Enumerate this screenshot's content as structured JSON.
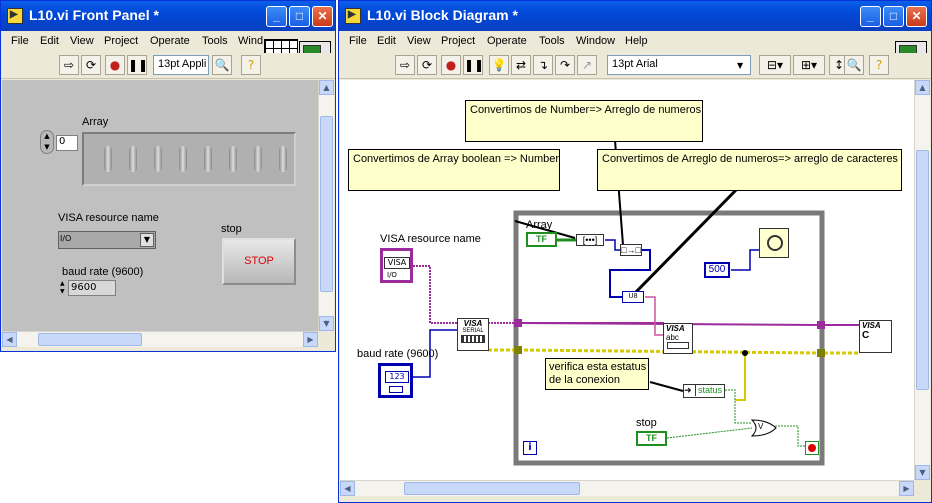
{
  "front_panel": {
    "title": "L10.vi Front Panel *",
    "menus": [
      "File",
      "Edit",
      "View",
      "Project",
      "Operate",
      "Tools",
      "Wind"
    ],
    "font_selector": "13pt Appli",
    "array_label": "Array",
    "array_index": "0",
    "visa_label": "VISA resource name",
    "visa_prefix": "I/O",
    "baud_label": "baud rate (9600)",
    "baud_value": "9600",
    "stop_label": "stop",
    "stop_button": "STOP"
  },
  "block_diagram": {
    "title": "L10.vi Block Diagram *",
    "menus": [
      "File",
      "Edit",
      "View",
      "Project",
      "Operate",
      "Tools",
      "Window",
      "Help"
    ],
    "font_selector": "13pt Arial",
    "comments": {
      "number_to_array": "Convertimos de Number=> Arreglo de numeros",
      "bool_to_number": "Convertimos de Array boolean => Number",
      "array_to_chars": "Convertimos de Arreglo de numeros=> arreglo de caracteres",
      "status_note_1": "verifica esta estatus",
      "status_note_2": "de la conexion"
    },
    "labels": {
      "array": "Array",
      "visa_resource": "VISA resource name",
      "baud_rate": "baud rate (9600)",
      "stop": "stop",
      "status": "status",
      "wait_value": "500",
      "tf": "TF",
      "visa": "VISA",
      "visa_serial_1": "VISA",
      "visa_serial_2": "SERIAL",
      "visa_write_abc": "abc",
      "u8": "U8",
      "baud_num": "123",
      "io": "I/O",
      "loop_i": "i",
      "close_c": "C",
      "or_v": "V"
    }
  },
  "colors": {
    "title_blue": "#0a50dd",
    "panel_gray": "#c0c0c0",
    "comment_yellow": "#ffffcc",
    "visa_wire": "#9c2c9c",
    "bool_green": "#1f8f1f",
    "numeric_blue": "#0000b0",
    "error_wire": "#cccc00"
  }
}
